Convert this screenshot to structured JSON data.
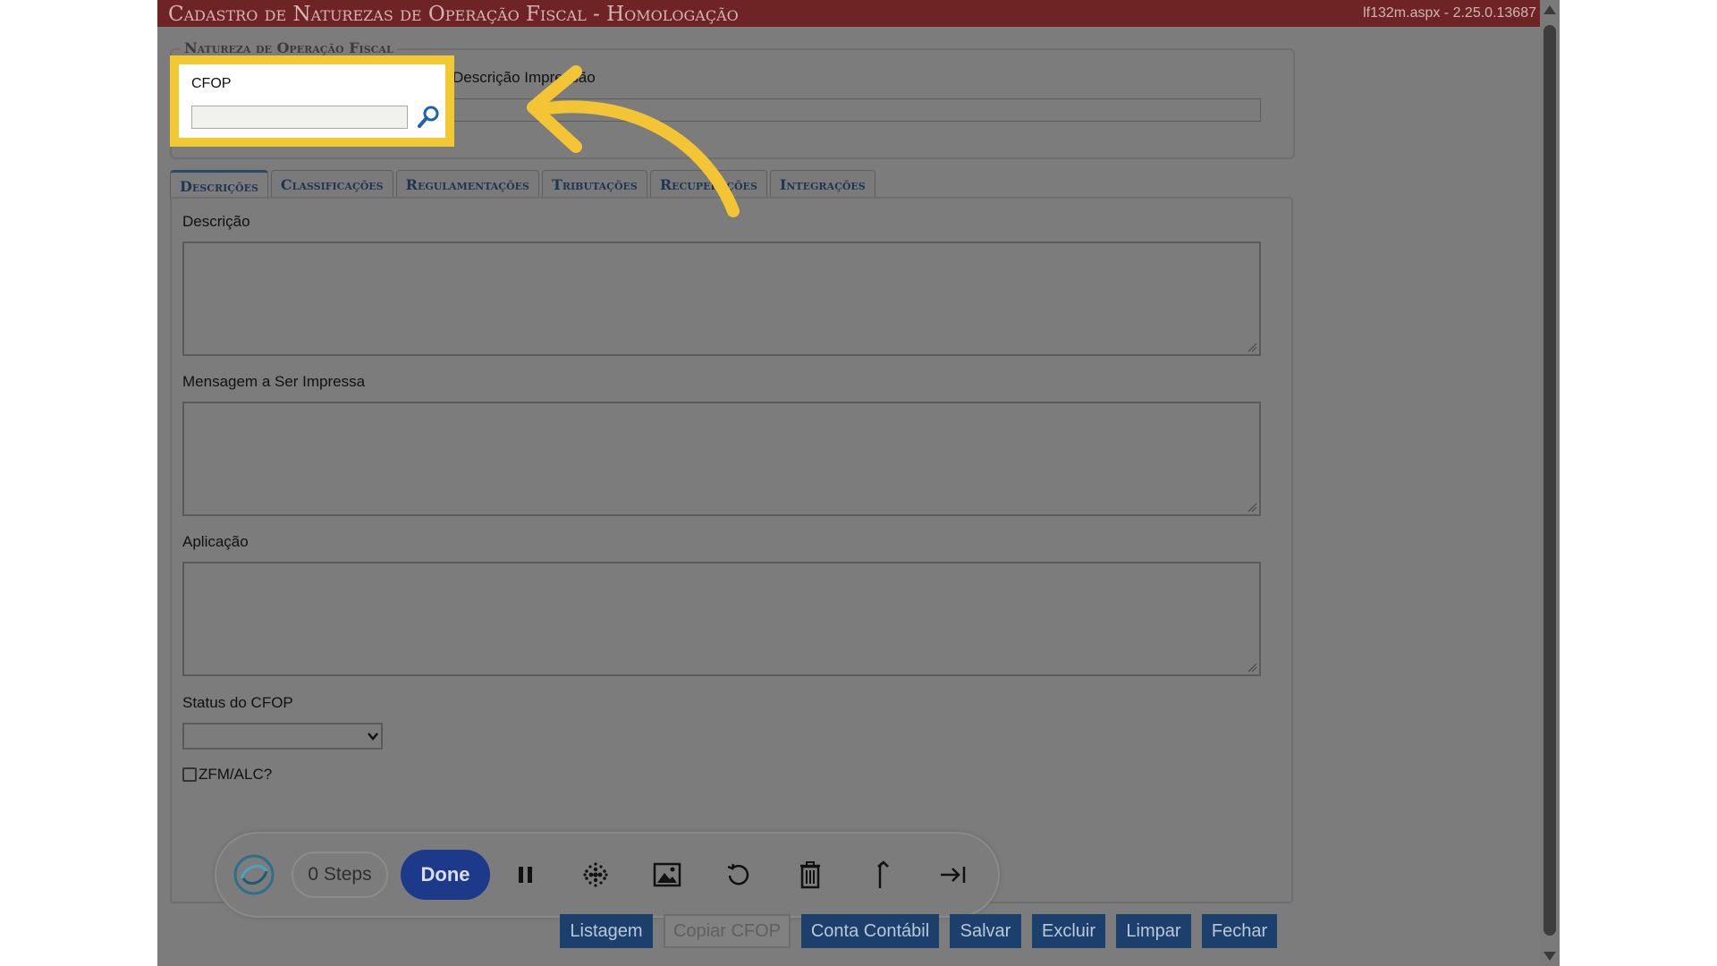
{
  "window": {
    "title": "Cadastro de Naturezas de Operação Fiscal  - Homologação",
    "version": "lf132m.aspx - 2.25.0.13687"
  },
  "natureza": {
    "legend": "Natureza de Operação Fiscal",
    "cfop_label": "CFOP",
    "cfop_value": "",
    "desc_impressao_label": "Descrição Impressão",
    "desc_impressao_value": ""
  },
  "tabs": [
    {
      "label": "Descrições",
      "active": true
    },
    {
      "label": "Classificações",
      "active": false
    },
    {
      "label": "Regulamentações",
      "active": false
    },
    {
      "label": "Tributações",
      "active": false
    },
    {
      "label": "Recuperações",
      "active": false
    },
    {
      "label": "Integrações",
      "active": false
    }
  ],
  "form": {
    "descricao_label": "Descrição",
    "mensagem_label": "Mensagem a Ser Impressa",
    "aplicacao_label": "Aplicação",
    "status_label": "Status do CFOP",
    "status_value": "",
    "zfm_label": "ZFM/ALC?",
    "zfm_checked": false
  },
  "toolbar": {
    "steps_label": "0 Steps",
    "done_label": "Done",
    "icons": [
      "pause-icon",
      "blur-icon",
      "image-icon",
      "undo-icon",
      "trash-icon",
      "branch-arrow-icon",
      "skip-to-end-icon"
    ]
  },
  "buttons": {
    "listagem": "Listagem",
    "copiar_cfop": "Copiar CFOP",
    "conta_contabil": "Conta Contábil",
    "salvar": "Salvar",
    "excluir": "Excluir",
    "limpar": "Limpar",
    "fechar": "Fechar"
  },
  "colors": {
    "titlebar": "#6e2324",
    "highlight": "#f1c933",
    "button": "#1c3f6b",
    "done_button": "#1d3a8a",
    "arrow": "#f3c535"
  }
}
